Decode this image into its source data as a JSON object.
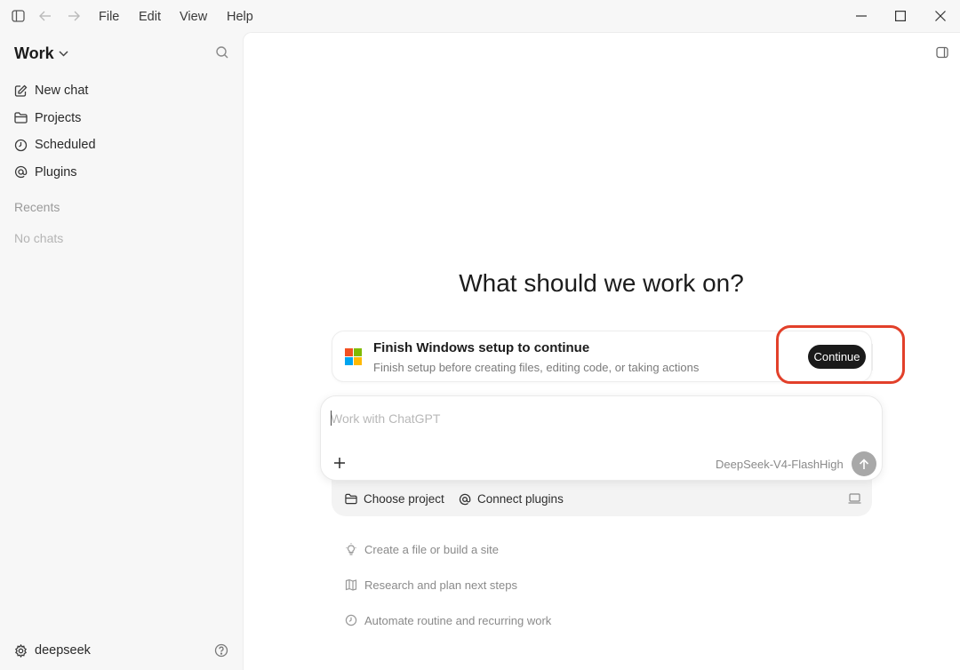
{
  "titlebar": {
    "menu": [
      "File",
      "Edit",
      "View",
      "Help"
    ]
  },
  "sidebar": {
    "workspace_title": "Work",
    "nav_items": [
      {
        "label": "New chat",
        "icon": "edit-icon"
      },
      {
        "label": "Projects",
        "icon": "folder-icon"
      },
      {
        "label": "Scheduled",
        "icon": "clock-icon"
      },
      {
        "label": "Plugins",
        "icon": "at-icon"
      }
    ],
    "recents_heading": "Recents",
    "empty_text": "No chats",
    "user_name": "deepseek"
  },
  "main": {
    "heading": "What should we work on?",
    "setup_card": {
      "title": "Finish Windows setup to continue",
      "subtitle": "Finish setup before creating files, editing code, or taking actions",
      "button_label": "Continue"
    },
    "composer": {
      "placeholder": "Work with ChatGPT",
      "model": "DeepSeek-V4-Flash",
      "effort": "High"
    },
    "tray": {
      "choose_project": "Choose project",
      "connect_plugins": "Connect plugins"
    },
    "suggestions": [
      {
        "label": "Create a file or build a site",
        "icon": "lightbulb-icon"
      },
      {
        "label": "Research and plan next steps",
        "icon": "map-icon"
      },
      {
        "label": "Automate routine and recurring work",
        "icon": "clock-icon"
      }
    ]
  },
  "colors": {
    "sidebar_bg": "#f7f7f7",
    "main_bg": "#ffffff",
    "button_dark": "#1a1a1a",
    "highlight": "#e2402a",
    "ms_red": "#f25022",
    "ms_green": "#7fba00",
    "ms_blue": "#00a4ef",
    "ms_yellow": "#ffb900"
  }
}
